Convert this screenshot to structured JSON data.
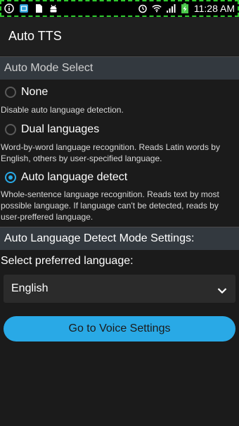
{
  "status_bar": {
    "time": "11:28 AM",
    "icons": [
      "info-icon",
      "screenshot-icon",
      "sd-card-icon",
      "android-icon",
      "alarm-icon",
      "wifi-icon",
      "signal-icon",
      "battery-charging-icon"
    ]
  },
  "app_bar": {
    "title": "Auto TTS"
  },
  "auto_mode": {
    "header": "Auto Mode Select",
    "options": [
      {
        "label": "None",
        "description": "Disable auto language detection.",
        "checked": false
      },
      {
        "label": "Dual languages",
        "description": "Word-by-word language recognition. Reads Latin words by English, others by user-specified language.",
        "checked": false
      },
      {
        "label": "Auto language detect",
        "description": "Whole-sentence language recognition. Reads text by most possible language. If language can't be detected, reads by user-preffered language.",
        "checked": true
      }
    ]
  },
  "detect_settings": {
    "header": "Auto Language Detect Mode Settings:",
    "preferred_label": "Select preferred language:",
    "preferred_value": "English"
  },
  "voice_button": {
    "label": "Go to Voice Settings"
  },
  "colors": {
    "accent": "#29a9e6",
    "background": "#1b1b1b",
    "section_header": "#33393f"
  }
}
